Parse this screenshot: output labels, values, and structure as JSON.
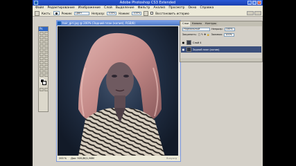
{
  "app": {
    "title": "Adobe Photoshop CS3 Extended"
  },
  "menu": [
    "Файл",
    "Редактирование",
    "Изображение",
    "Слой",
    "Выделение",
    "Фильтр",
    "Анализ",
    "Просмотр",
    "Окно",
    "Справка"
  ],
  "options": {
    "brush_label": "Кисть:",
    "mode_label": "Режим:",
    "mode_value": "Цвет",
    "opacity_label": "Непрозр:",
    "opacity_value": "100%",
    "flow_label": "Нажим:",
    "flow_value": "100%",
    "history_label": "Восстановить историю"
  },
  "toolbox": {
    "header": "Ps"
  },
  "document": {
    "title": "hair_girl.jpg @ 200% (Задний план (копия), RGB/8)",
    "zoom": "200 %",
    "doc_info": "Док: 909,8K/1,98M",
    "watermark": "Busy.org"
  },
  "layers_panel": {
    "tabs": [
      "Слои",
      "Каналы",
      "Контуры"
    ],
    "blend_mode": "Нормальный",
    "opacity_label": "Непрозр:",
    "opacity_value": "100%",
    "lock_label": "Закрепить:",
    "fill_label": "Заливка:",
    "fill_value": "100%",
    "layers": [
      {
        "name": "Слой 4",
        "selected": false
      },
      {
        "name": "Задний план (копия)",
        "selected": true
      }
    ]
  },
  "colors": {
    "accent": "#2a5ad7",
    "selected_layer": "#3b4f7c",
    "hair": "#c9908e"
  }
}
